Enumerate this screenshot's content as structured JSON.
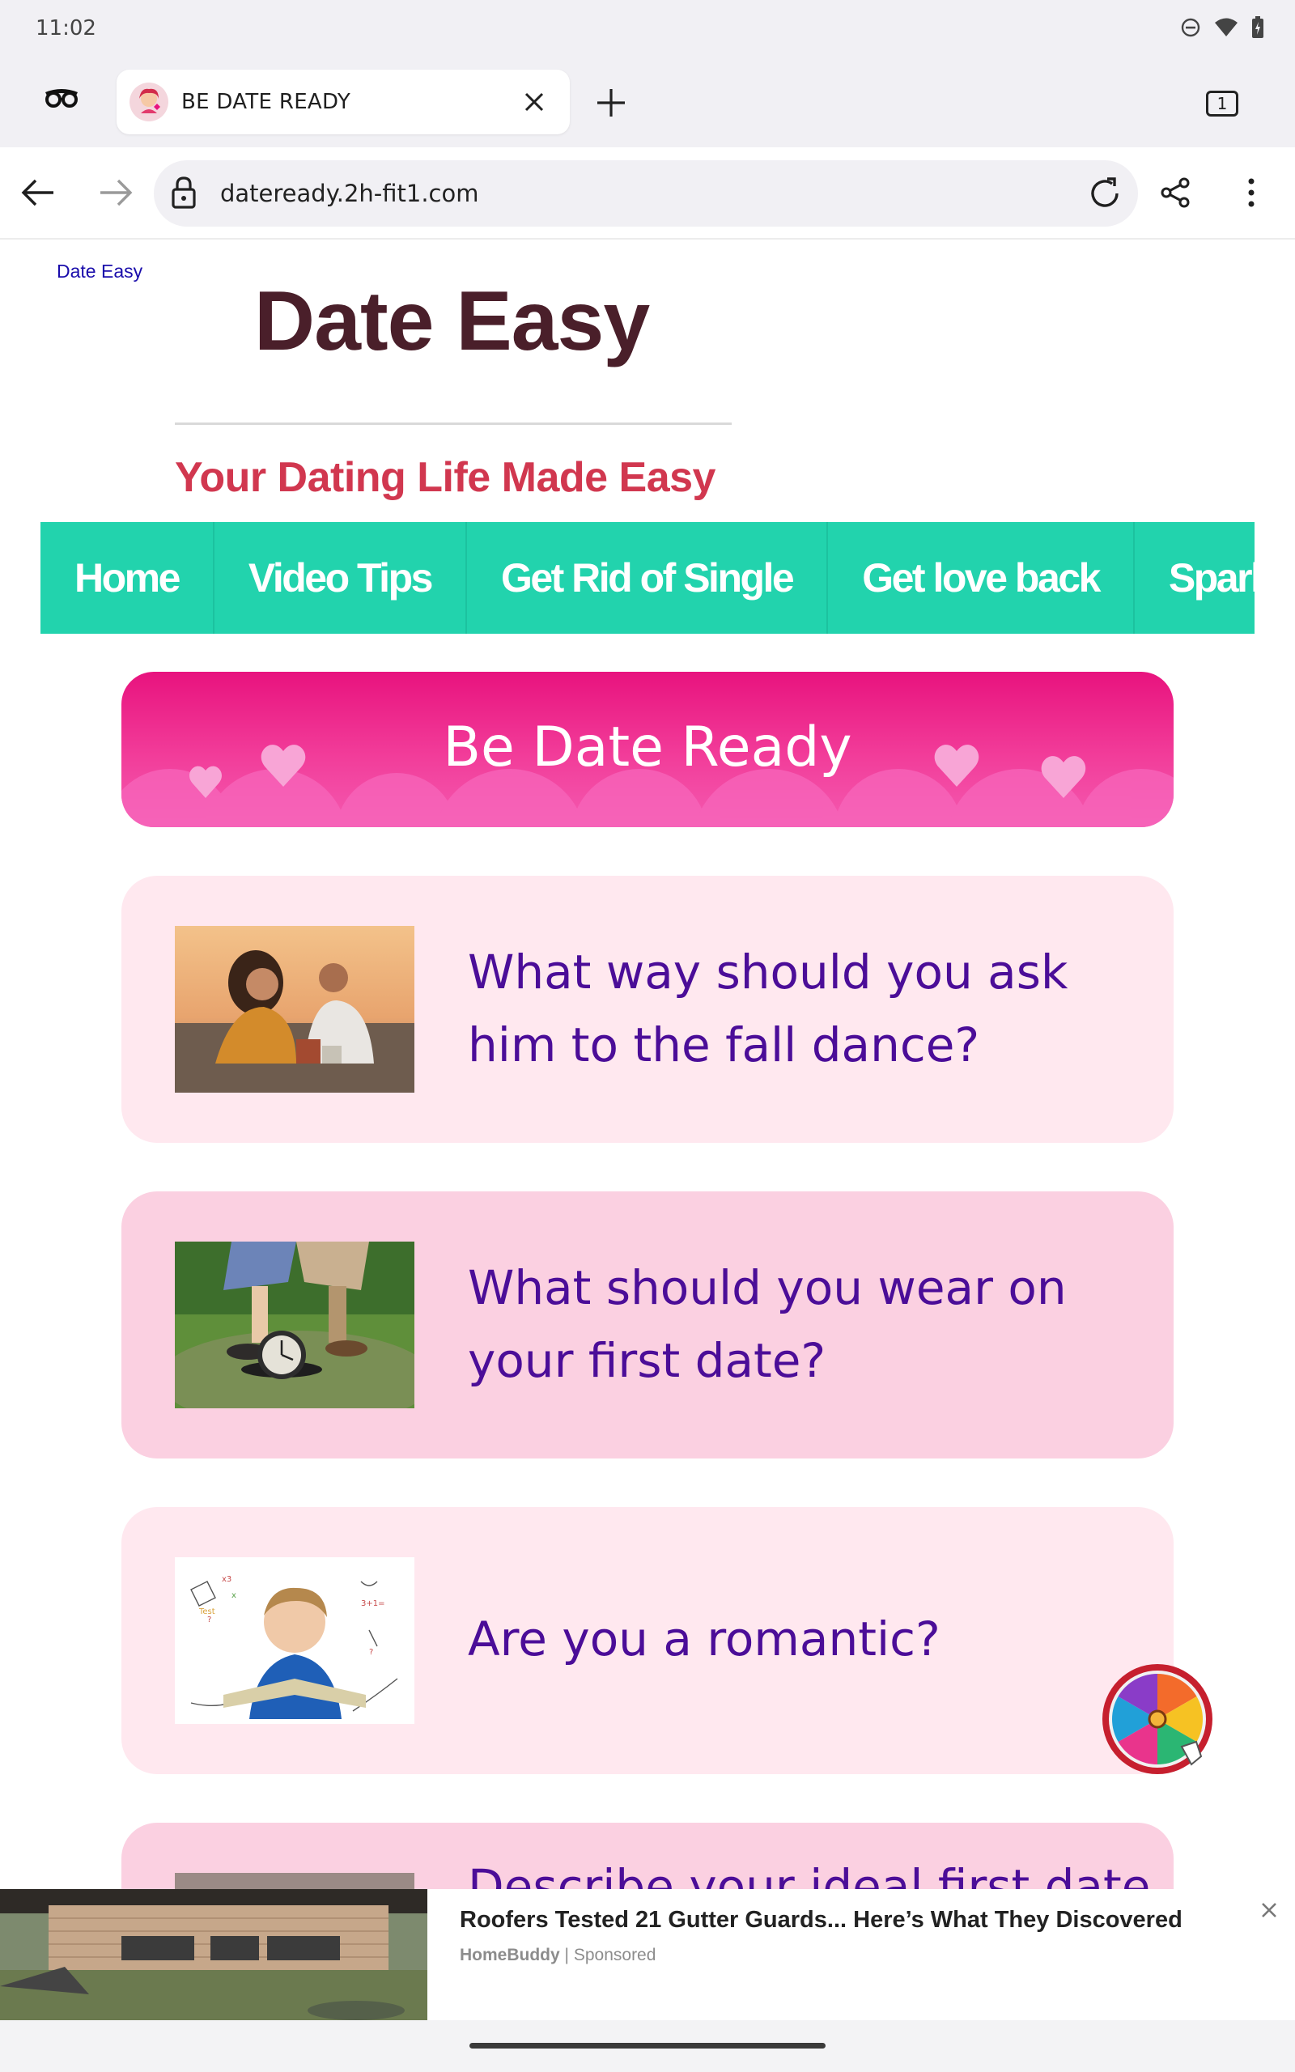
{
  "status_bar": {
    "time": "11:02",
    "icons": [
      "do-not-disturb-icon",
      "wifi-icon",
      "battery-icon"
    ]
  },
  "browser": {
    "tab": {
      "title": "BE DATE READY"
    },
    "tab_count": "1",
    "url": "dateready.2h-fit1.com"
  },
  "site": {
    "link_text": "Date Easy",
    "title": "Date Easy",
    "tagline": "Your Dating Life Made Easy",
    "nav": [
      "Home",
      "Video Tips",
      "Get Rid of Single",
      "Get love back",
      "Spark"
    ],
    "banner": "Be Date Ready",
    "cards": [
      {
        "text": "What way should you ask him to the fall dance?"
      },
      {
        "text": "What should you wear on your first date?"
      },
      {
        "text": "Are you a romantic?"
      },
      {
        "text": "Describe your ideal first date"
      }
    ]
  },
  "ad": {
    "title": "Roofers Tested 21 Gutter Guards... Here’s What They Discovered",
    "source": "HomeBuddy",
    "sponsored": "Sponsored",
    "separator": "|"
  },
  "colors": {
    "nav_bg": "#22d3ad",
    "tagline": "#d1374f",
    "title": "#4a1f2a",
    "card_text": "#4b0d98",
    "banner": "#e8137e"
  }
}
